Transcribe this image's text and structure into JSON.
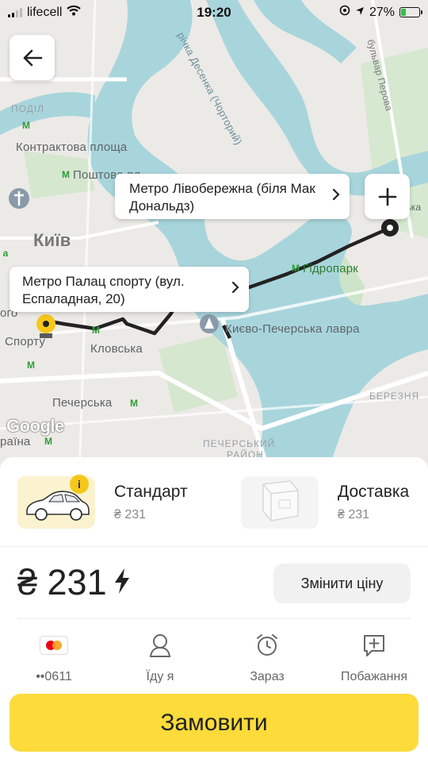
{
  "status_bar": {
    "carrier": "lifecell",
    "time": "19:20",
    "battery_percent": "27%",
    "battery_level": 0.27
  },
  "map": {
    "labels": {
      "podil": "ПОДІЛ",
      "kontraktova": "Контрактова площа",
      "poshtova": "Поштова пл.",
      "kyiv": "Київ",
      "hidropark": "Гідропарк",
      "lavra": "Києво-Печерська лавра",
      "klovska": "Кловська",
      "pecherska": "Печерська",
      "sportu": "Спорту",
      "hoho": "ого",
      "aina": "раїна",
      "pechersky_raion_1": "ПЕЧЕРСЬКИЙ",
      "pechersky_raion_2": "РАЙОН",
      "berezniaky": "БЕРЕЗНЯ",
      "river": "річка Десенка (Чорторий)",
      "street": "бульвар Перова",
      "ska": "ська",
      "google": "Google"
    },
    "colors": {
      "land": "#eceae6",
      "water": "#a8d5dc",
      "park": "#cde4c8",
      "route": "#222222",
      "origin_pin": "#f6c71a"
    }
  },
  "bubbles": {
    "destination": "Метро Лівобережна (біля Мак Дональдз)",
    "origin": "Метро Палац спорту (вул. Еспаладная, 20)"
  },
  "tariffs": [
    {
      "name": "Стандарт",
      "price": "₴ 231",
      "selected": true
    },
    {
      "name": "Доставка",
      "price": "₴ 231",
      "selected": false
    }
  ],
  "price": {
    "value": "₴ 231",
    "change_label": "Змінити ціну"
  },
  "options": {
    "card": "••0611",
    "going": "Їду я",
    "now": "Зараз",
    "wishes": "Побажання"
  },
  "order_button": "Замовити",
  "icons": {
    "back": "arrow-left-icon",
    "plus": "plus-icon",
    "card": "mastercard-icon",
    "person": "person-icon",
    "clock": "alarm-clock-icon",
    "wishes": "message-plus-icon",
    "lightning": "lightning-icon"
  }
}
